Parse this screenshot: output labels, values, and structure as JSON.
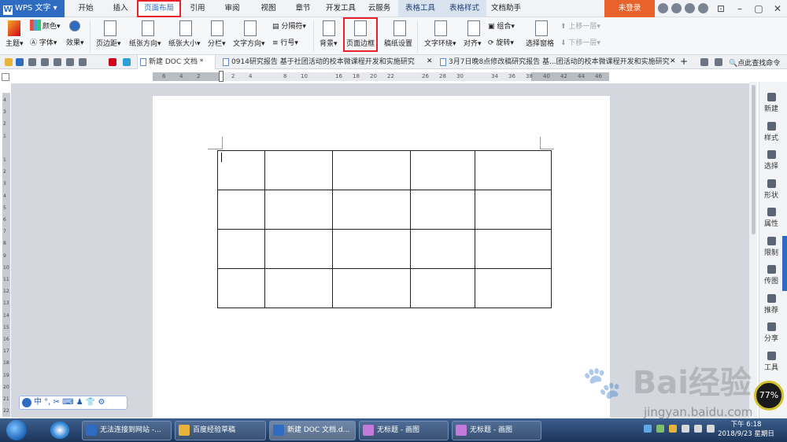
{
  "app": {
    "name": "WPS 文字"
  },
  "menu": {
    "tabs": [
      "开始",
      "插入",
      "页面布局",
      "引用",
      "审阅",
      "视图",
      "章节",
      "开发工具",
      "云服务"
    ],
    "context_tabs": [
      "表格工具",
      "表格样式"
    ],
    "assistant": "文档助手",
    "login": "未登录"
  },
  "ribbon": {
    "theme": "主题",
    "color": "颜色",
    "font": "字体",
    "effect": "效果",
    "margins": "页边距",
    "orientation": "纸张方向",
    "size": "纸张大小",
    "columns": "分栏",
    "text_direction": "文字方向",
    "separator": "分隔符",
    "line_numbers": "行号",
    "background": "背景",
    "page_border": "页面边框",
    "grid_paper": "稿纸设置",
    "text_wrap": "文字环绕",
    "align": "对齐",
    "group": "组合",
    "rotate": "旋转",
    "selection_pane": "选择窗格",
    "bring_forward": "上移一层",
    "send_backward": "下移一层"
  },
  "doc_tabs": [
    "新建 DOC 文档 *",
    "0914研究报告 基于社团活动的校本微课程开发和实施研究",
    "3月7日晚8点修改稿研究报告 基...团活动的校本微课程开发和实施研究"
  ],
  "search_cmd": "点此查找命令",
  "ruler": {
    "h": [
      "6",
      "4",
      "2",
      "",
      "2",
      "4",
      "",
      "8",
      "10",
      "",
      "16",
      "18",
      "20",
      "22",
      "",
      "26",
      "28",
      "30",
      "",
      "34",
      "36",
      "38",
      "40",
      "42",
      "44",
      "46"
    ],
    "v": [
      "4",
      "3",
      "2",
      "1",
      "",
      "1",
      "2",
      "3",
      "4",
      "5",
      "6",
      "7",
      "8",
      "9",
      "10",
      "11",
      "12",
      "13",
      "14",
      "15",
      "16",
      "17",
      "18",
      "19",
      "20",
      "21",
      "22"
    ]
  },
  "table": {
    "rows": 4,
    "cols": 5
  },
  "right_panel": [
    "新建",
    "样式",
    "选择",
    "形状",
    "属性",
    "限制",
    "传图",
    "推荐",
    "分享",
    "工具"
  ],
  "ime": {
    "label": "中"
  },
  "taskbar": {
    "items": [
      "无法连接到网站 -...",
      "百度经验草稿",
      "新建 DOC 文档.d...",
      "无标题 - 画图",
      "无标题 - 画图"
    ],
    "time": "下午 6:18",
    "date": "2018/9/23 星期日"
  },
  "gauge": "77",
  "watermark": {
    "logo": "Bai经验",
    "url": "jingyan.baidu.com"
  },
  "colors": {
    "accent": "#2d6cc0",
    "highlight": "#e8212a",
    "login": "#e8632b"
  }
}
